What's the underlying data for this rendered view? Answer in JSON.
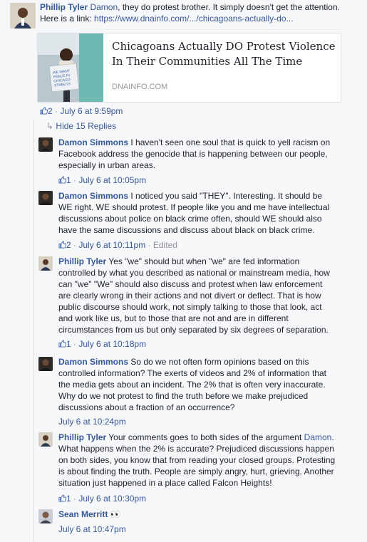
{
  "top_comment": {
    "author": "Phillip Tyler",
    "mention": "Damon",
    "text_rest": ", they do protest brother. It simply doesn't get the attention.",
    "line2_prefix": "Here is a link: ",
    "link": "https://www.dnainfo.com/.../chicagoans-actually-do...",
    "likes": "2",
    "time": "July 6 at 9:59pm"
  },
  "link_card": {
    "title": "Chicagoans Actually DO Protest Violence In Their Communities All The Time",
    "domain": "DNAINFO.COM",
    "sign_text": "WE WANT PEACE IN CHICAGO STREETS"
  },
  "hide_replies": {
    "arrow": "↳",
    "label": "Hide 15 Replies"
  },
  "replies": [
    {
      "author": "Damon Simmons",
      "lines": [
        "I haven't seen one soul that is quick to yell racism on",
        "Facebook address the genocide that is happening between our people,",
        "especially in urban areas."
      ],
      "likes": "1",
      "time": "July 6 at 10:05pm",
      "edited": ""
    },
    {
      "author": "Damon Simmons",
      "lines": [
        "I noticed you said \"THEY\". Interesting. It should be",
        "WE right. WE should protest. If people like you and me have intellectual",
        "discussions about police on black crime often, should WE should also",
        "have the same discussions and discuss about black on black crime."
      ],
      "likes": "2",
      "time": "July 6 at 10:11pm",
      "edited": "Edited"
    },
    {
      "author": "Phillip Tyler",
      "lines": [
        "Yes \"we\" should but when \"we\" are fed information",
        "controlled by what you described as national or mainstream media, how",
        "can \"we\" \"We\" should also discuss and protest when law enforcement",
        "are clearly wrong in their actions and not divert or deflect. That is how",
        "public discourse should work, not simply talking to those that look, act",
        "and work like us, but to those that are not and are in different",
        "circumstances from us but only separated by six degrees of separation."
      ],
      "likes": "1",
      "time": "July 6 at 10:18pm",
      "edited": ""
    },
    {
      "author": "Damon Simmons",
      "lines": [
        "So do we not often form opinions based on this",
        "controlled information? The exerts of videos and 2% of information that",
        "the media gets about an incident. The 2% that is often very inaccurate.",
        "Why do we not protest to find the truth before we make prejudiced",
        "discussions about a fraction of an occurrence?"
      ],
      "likes": "",
      "time": "July 6 at 10:24pm",
      "edited": ""
    },
    {
      "author": "Phillip Tyler",
      "lines": [
        "Your comments goes to both sides of the argument",
        "What happens when the 2% is accurate? Prejudiced discussions happen",
        "on both sides, you know that from reading your closed groups. Protesting",
        "is about finding the truth. People are simply angry, hurt, grieving. Another",
        "situation just happened in a place called Falcon Heights!"
      ],
      "mention": "Damon",
      "mention_suffix": ".",
      "likes": "1",
      "time": "July 6 at 10:30pm",
      "edited": ""
    },
    {
      "author": "Sean Merritt",
      "emoji": "👀",
      "lines": [],
      "likes": "",
      "time": "July 6 at 10:47pm",
      "edited": ""
    }
  ],
  "colors": {
    "link": "#365899",
    "meta": "#90949c",
    "background": "#f6f7f9"
  }
}
